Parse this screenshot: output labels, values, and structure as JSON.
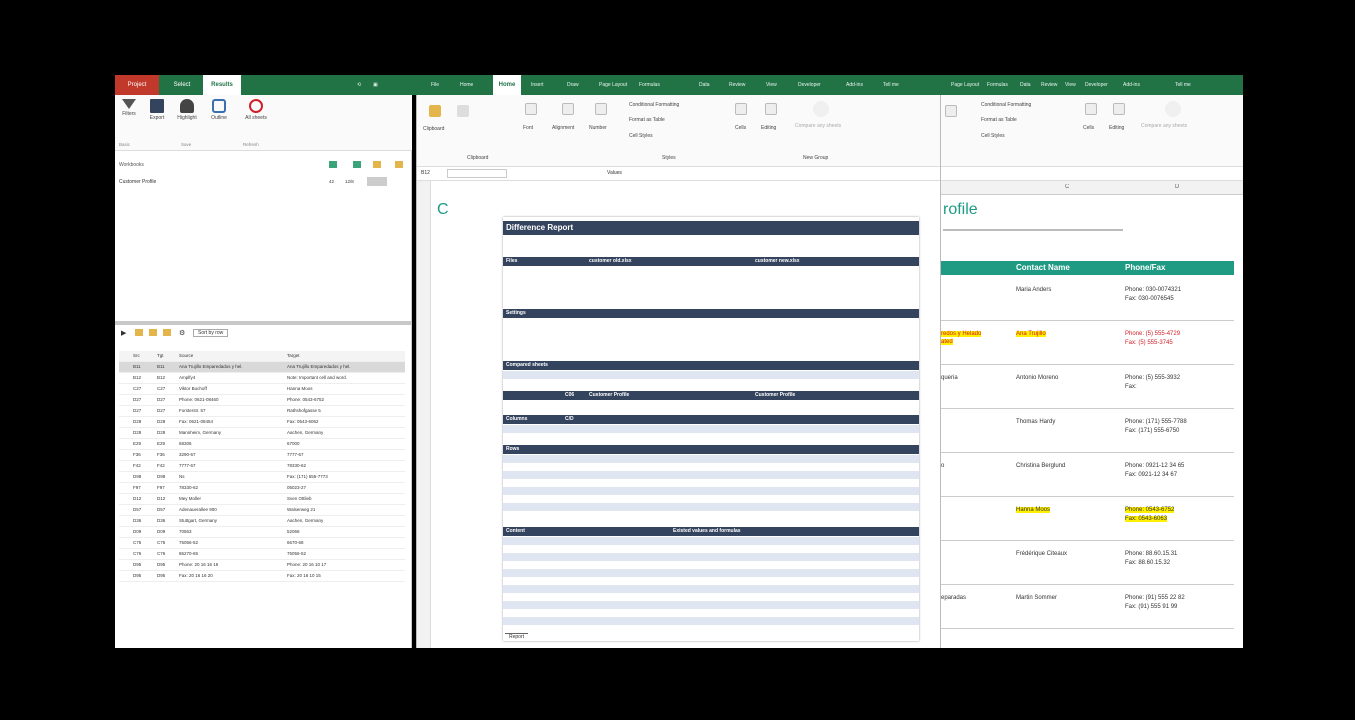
{
  "topbar": {
    "left_tabs": [
      "Project",
      "Select",
      "Results"
    ],
    "mid_tabs": [
      "File",
      "Home",
      "Insert",
      "Draw",
      "Page Layout",
      "Formulas",
      "Data",
      "Review",
      "View",
      "Developer",
      "Add-ins",
      "Tell me"
    ],
    "right_tabs": [
      "Page Layout",
      "Formulas",
      "Data",
      "Review",
      "View",
      "Developer",
      "Add-ins",
      "Tell me"
    ]
  },
  "left_pane": {
    "ribbon": [
      {
        "label": "Filters",
        "icon": "filter-icon"
      },
      {
        "label": "Export",
        "icon": "save-icon"
      },
      {
        "label": "Highlight",
        "icon": "binoculars-icon"
      },
      {
        "label": "Outline",
        "icon": "outline-icon"
      },
      {
        "label": "All sheets",
        "icon": "refresh-icon"
      }
    ],
    "groups": [
      "Basic",
      "Save",
      "Refresh"
    ],
    "workbook_label": "Workbooks",
    "list_item": "Customer Profile",
    "list_item_counts": [
      "42",
      "12/8"
    ],
    "sort_label": "Sort by row",
    "grid_headers": [
      "Src",
      "Tgt",
      "Source",
      "Target"
    ],
    "grid_rows": [
      [
        "B11",
        "B11",
        "Ana Trujillo Emparedados y hel.",
        "Ana Trujillo Emparedados y hel."
      ],
      [
        "B12",
        "B12",
        "Amplfy4",
        "Note: Important cell and word."
      ],
      [
        "C27",
        "C27",
        "Viktor Buchoff",
        "Hanna Moos"
      ],
      [
        "D27",
        "D27",
        "Phone: 0621-08460",
        "Phone: 0543-6752"
      ],
      [
        "D27",
        "D27",
        "Forsterstr. 57",
        "Rathshofgasse 5"
      ],
      [
        "D28",
        "D28",
        "Fax: 0621-08454",
        "Fax: 0543-6062"
      ],
      [
        "D28",
        "D28",
        "Mannheim, Germany",
        "Aachen, Germany"
      ],
      [
        "E29",
        "E29",
        "68306",
        "67000"
      ],
      [
        "F36",
        "F36",
        "3290-67",
        "7777-67"
      ],
      [
        "F42",
        "F42",
        "7777-67",
        "78330-62"
      ],
      [
        "D98",
        "D98",
        "Ns",
        "Fax: (171) 555-7773"
      ],
      [
        "F97",
        "F97",
        "78330-62",
        "05023-27"
      ],
      [
        "D12",
        "D12",
        "Mey Moller",
        "Sven Ottlieb"
      ],
      [
        "D57",
        "D57",
        "Adenauerallee 900",
        "Walserweg 21"
      ],
      [
        "D36",
        "D36",
        "Stuttgart, Germany",
        "Aachen, Germany"
      ],
      [
        "D09",
        "D09",
        "70563",
        "52066"
      ],
      [
        "C75",
        "C75",
        "75056-52",
        "6670-68"
      ],
      [
        "C76",
        "C76",
        "86270-65",
        "75056-52"
      ],
      [
        "D95",
        "D95",
        "Phone: 20 16 16 16",
        "Phone: 20 16 10 17"
      ],
      [
        "D95",
        "D95",
        "Fax: 20 16 16 20",
        "Fax: 20 16 10 15"
      ]
    ]
  },
  "mid_window": {
    "ribbon_groups": [
      "Clipboard",
      "Font",
      "Alignment",
      "Number",
      "Styles",
      "Cells",
      "Editing",
      "New Group"
    ],
    "ribbon_items": [
      "Conditional Formatting",
      "Format as Table",
      "Cell Styles",
      "Compare any sheets"
    ],
    "name_box": "B12",
    "formula_value": "Values",
    "report": {
      "title": "Difference Report",
      "sections": [
        {
          "label": "Files",
          "cols": [
            "customer old.xlsx",
            "customer new.xlsx"
          ]
        },
        {
          "label": "Settings",
          "cols": [
            "",
            ""
          ]
        },
        {
          "label": "Compared sheets",
          "cols": [
            "",
            ""
          ]
        },
        {
          "label": "Columns",
          "cols": [
            "C/D",
            ""
          ]
        },
        {
          "label": "Rows",
          "cols": [
            "",
            ""
          ]
        },
        {
          "label": "Content",
          "cols": [
            "Existed values and formulas",
            ""
          ]
        }
      ],
      "compared": [
        "C06",
        "Customer Profile",
        "Customer Profile"
      ],
      "footer_tab": "Report"
    }
  },
  "right_window": {
    "ribbon_items": [
      "Conditional Formatting",
      "Format as Table",
      "Cell Styles",
      "Cells",
      "Editing",
      "Compare any sheets"
    ],
    "col_headers": [
      "C",
      "D"
    ],
    "title": "rofile",
    "table_headers": [
      "Contact Name",
      "Phone/Fax"
    ],
    "rows": [
      {
        "company": "",
        "contact": "Maria Anders",
        "phone": "Phone: 030-0074321",
        "fax": "Fax: 030-0076545",
        "contact_hl": false,
        "phone_hl": false,
        "red": false
      },
      {
        "company": "redos y Helado",
        "company2": "ated",
        "contact": "Ana Trujillo",
        "phone": "Phone: (5) 555-4729",
        "fax": "Fax: (5) 555-3745",
        "contact_hl": true,
        "phone_hl": false,
        "red": true
      },
      {
        "company": "queria",
        "contact": "Antonio Moreno",
        "phone": "Phone: (5) 555-3932",
        "fax": "Fax:",
        "contact_hl": false,
        "phone_hl": false,
        "red": false
      },
      {
        "company": "",
        "contact": "Thomas Hardy",
        "phone": "Phone: (171) 555-7788",
        "fax": "Fax: (171) 555-6750",
        "contact_hl": false,
        "phone_hl": false,
        "red": false
      },
      {
        "company": "o",
        "contact": "Christina Berglund",
        "phone": "Phone: 0921-12 34 65",
        "fax": "Fax: 0921-12 34 67",
        "contact_hl": false,
        "phone_hl": false,
        "red": false
      },
      {
        "company": "",
        "contact": "Hanna Moos",
        "phone": "Phone: 0543-6752",
        "fax": "Fax: 0543-6063",
        "contact_hl": true,
        "phone_hl": true,
        "red": false
      },
      {
        "company": "",
        "contact": "Frédérique Citeaux",
        "phone": "Phone: 88.60.15.31",
        "fax": "Fax: 88.60.15.32",
        "contact_hl": false,
        "phone_hl": false,
        "red": false
      },
      {
        "company": "eparadas",
        "contact": "Martin Sommer",
        "phone": "Phone: (91) 555 22 82",
        "fax": "Fax: (91) 555 91 99",
        "contact_hl": false,
        "phone_hl": false,
        "red": false
      }
    ]
  }
}
